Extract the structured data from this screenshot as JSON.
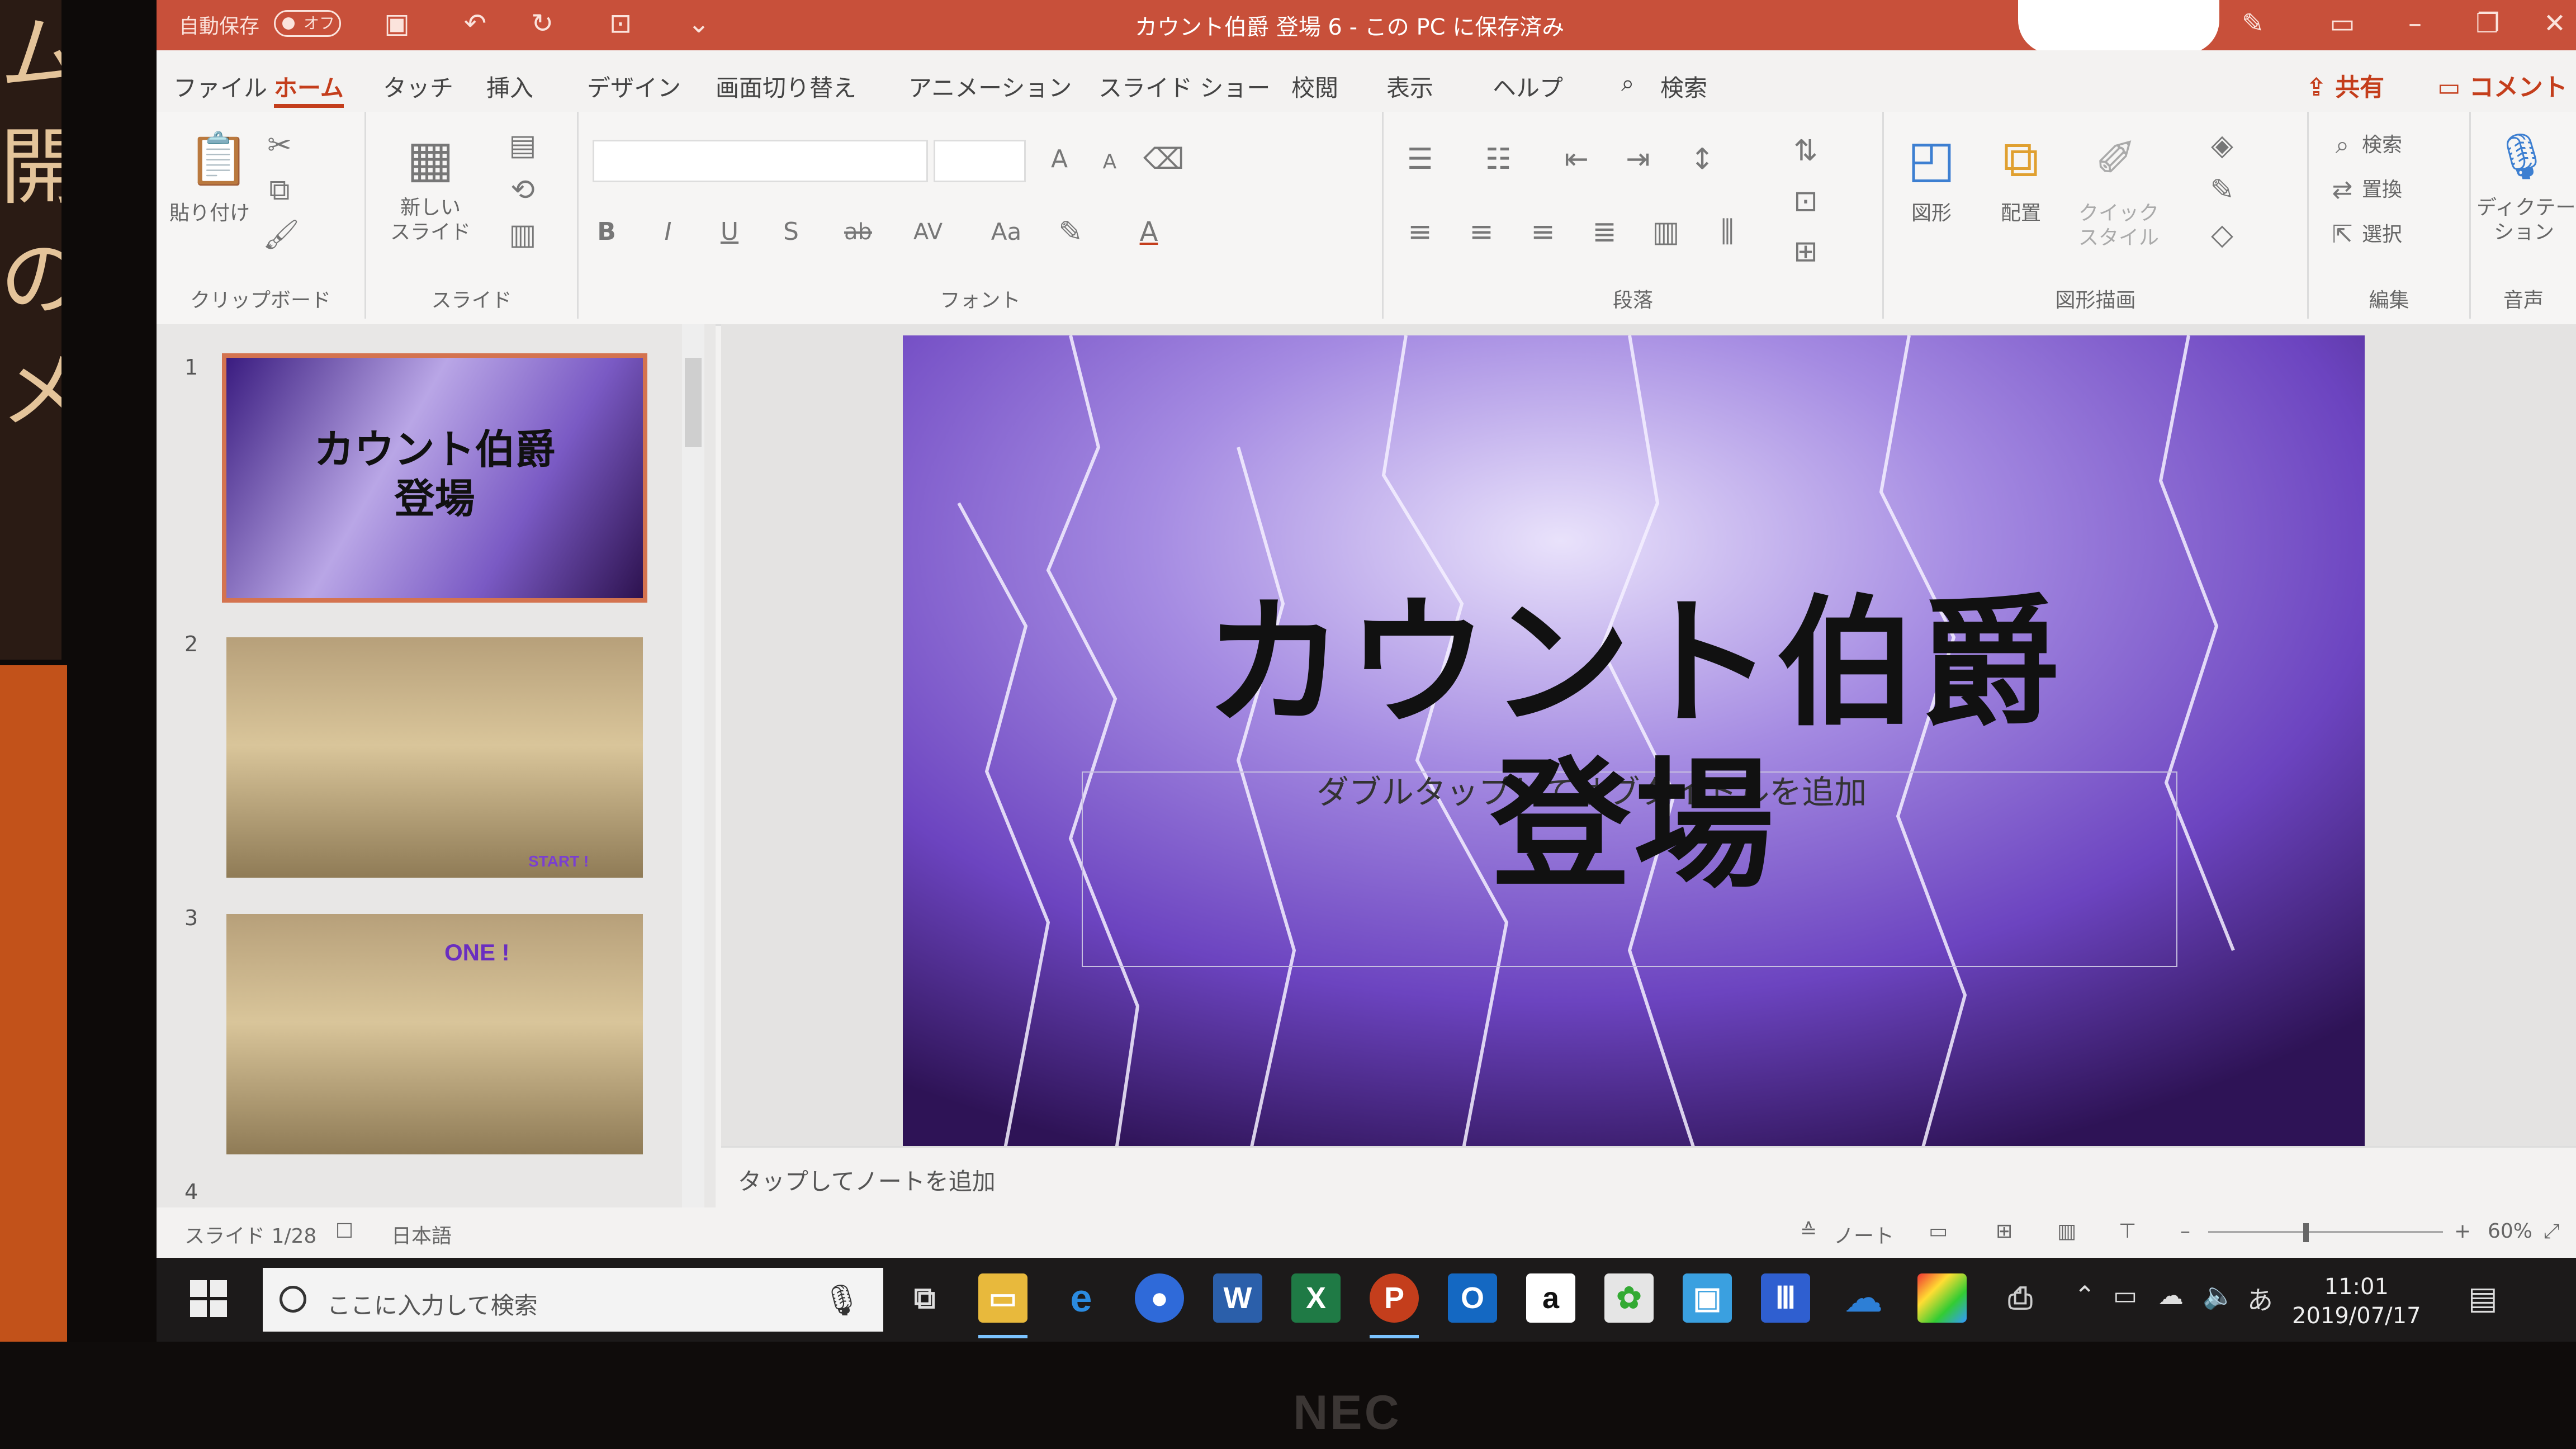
{
  "titlebar": {
    "autosave_label": "自動保存",
    "autosave_state": "オフ",
    "document_title": "カウント伯爵 登場 6 - この PC に保存済み"
  },
  "ribbon_tabs": [
    "ファイル",
    "ホーム",
    "タッチ",
    "挿入",
    "デザイン",
    "画面切り替え",
    "アニメーション",
    "スライド ショー",
    "校閲",
    "表示",
    "ヘルプ"
  ],
  "search_label": "検索",
  "share_label": "共有",
  "comment_label": "コメント",
  "ribbon": {
    "clipboard": {
      "paste": "貼り付け",
      "label": "クリップボード"
    },
    "slides": {
      "new_slide": "新しい\nスライド",
      "label": "スライド"
    },
    "font": {
      "label": "フォント",
      "bold": "B",
      "italic": "I",
      "underline": "U",
      "shadow": "S",
      "strike": "ab",
      "spacing": "AV",
      "case": "Aa",
      "font_color": "A",
      "grow": "A",
      "shrink": "A"
    },
    "paragraph": {
      "label": "段落"
    },
    "drawing": {
      "shapes": "図形",
      "arrange": "配置",
      "quick_style": "クイック\nスタイル",
      "label": "図形描画"
    },
    "editing": {
      "find": "検索",
      "replace": "置換",
      "select": "選択",
      "label": "編集"
    },
    "voice": {
      "dictate": "ディクテー\nション",
      "label": "音声"
    }
  },
  "thumbnails": [
    {
      "num": "1",
      "title": "カウント伯爵\n登場"
    },
    {
      "num": "2",
      "caption": "START !"
    },
    {
      "num": "3",
      "caption": "ONE !"
    },
    {
      "num": "4"
    }
  ],
  "slide": {
    "title_line1": "カウント伯爵",
    "title_line2": "登場",
    "subtitle_placeholder": "ダブルタップしてサブタイトルを追加"
  },
  "notes_placeholder": "タップしてノートを追加",
  "status": {
    "slide_count": "スライド 1/28",
    "language": "日本語",
    "notes": "ノート",
    "zoom": "60%"
  },
  "taskbar": {
    "search_placeholder": "ここに入力して検索",
    "ime": "あ",
    "time": "11:01",
    "date": "2019/07/17"
  },
  "laptop_brand": "NEC",
  "colors": {
    "titlebar": "#c8503a",
    "accent": "#c43e1c",
    "slide_purple": "#7f5bc9"
  }
}
